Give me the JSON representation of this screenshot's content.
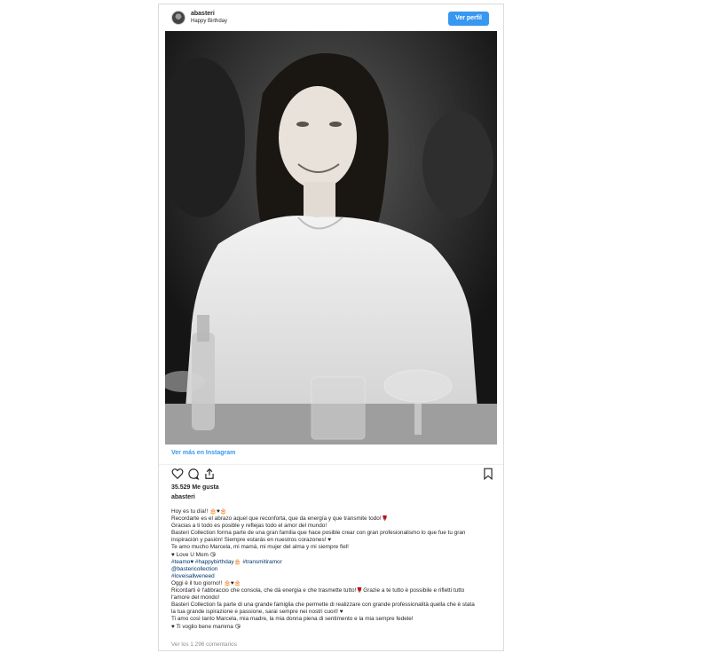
{
  "post": {
    "username": "abasteri",
    "subtitle": "Happy Birthday",
    "follow_label": "Ver perfil",
    "view_more": "Ver más en Instagram",
    "likes": "35.529 Me gusta",
    "owner": "abasteri",
    "comments_link": "Ver los 1.296 comentarios"
  },
  "caption": [
    "Hoy es tu día!! 🎂♥🎂",
    "Recordarte es el abrazo aquel que reconforta, que da energía y que transmite todo!🌹",
    "Gracias a ti todo es posible y reflejas todo el amor del mundo!",
    "Basteri Collection forma parte de una gran familia que hace posible crear con gran profesionalismo lo que fue tu gran",
    "inspiración y pasión! Siempre estarás en nuestros corazones! ♥",
    "Te amo mucho Marcela, mi mamá, mi mujer del alma y mi siempre fiel!",
    "♥ Love U Mom 😘",
    "#teamo♥ #happybirthday🎂 #transmitiramor",
    "@bastericollection",
    "#loveisallweneed",
    "Oggi è il tuo giorno!! 🎂♥🎂",
    "Ricordarti è l'abbraccio che consola, che dà energia e che trasmette tutto!🌹Grazie a te tutto è possibile e rifletti tutto",
    "l'amore del mondo!",
    "Basteri Collection fa parte di una grande famiglia che permette di realizzare con grande professionalità quella che è stata",
    "la tua grande ispirazione e passione, sarai sempre nei nostri cuori! ♥",
    "Ti amo così tanto Marcela, mia madre, la mia donna piena di sentimento e la mia sempre fedele!",
    "♥ Ti voglio bene mamma 😘"
  ],
  "icons": {
    "like": "heart-icon",
    "comment": "comment-icon",
    "share": "share-icon",
    "save": "bookmark-icon"
  },
  "colors": {
    "accent": "#3897f0",
    "hashtag": "#003569",
    "muted": "#8e8e8e"
  }
}
